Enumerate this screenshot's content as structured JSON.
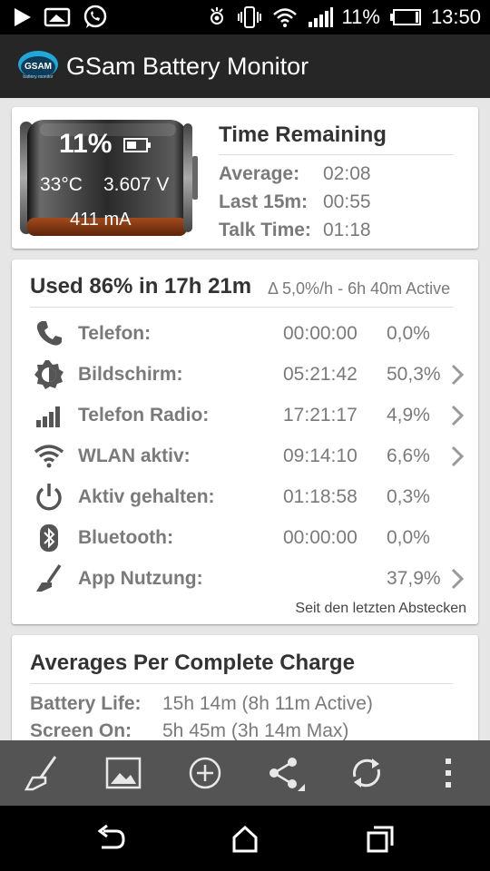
{
  "status_bar": {
    "battery_percent": "11%",
    "time": "13:50",
    "icons": [
      "play-icon",
      "image-icon",
      "whatsapp-icon",
      "gyroscope-icon",
      "vibrate-icon",
      "wifi-icon",
      "signal-icon",
      "battery-icon"
    ]
  },
  "app_bar": {
    "title": "GSam Battery Monitor",
    "logo_text": "GSAM",
    "logo_subtext": "battery monitor"
  },
  "battery_card": {
    "percent": "11%",
    "temperature": "33°C",
    "voltage": "3.607 V",
    "current": "411 mA",
    "charge_level": 0.11,
    "time_remaining": {
      "title": "Time Remaining",
      "rows": [
        {
          "label": "Average:",
          "value": "02:08"
        },
        {
          "label": "Last 15m:",
          "value": "00:55"
        },
        {
          "label": "Talk Time:",
          "value": "01:18"
        }
      ]
    }
  },
  "usage_card": {
    "headline": "Used 86% in 17h 21m",
    "subline": "Δ 5,0%/h - 6h 40m Active",
    "rows": [
      {
        "icon": "phone-icon",
        "label": "Telefon:",
        "time": "00:00:00",
        "percent": "0,0%",
        "has_chevron": false
      },
      {
        "icon": "brightness-icon",
        "label": "Bildschirm:",
        "time": "05:21:42",
        "percent": "50,3%",
        "has_chevron": true
      },
      {
        "icon": "signal-bars-icon",
        "label": "Telefon Radio:",
        "time": "17:21:17",
        "percent": "4,9%",
        "has_chevron": true
      },
      {
        "icon": "wifi-icon",
        "label": "WLAN aktiv:",
        "time": "09:14:10",
        "percent": "6,6%",
        "has_chevron": true
      },
      {
        "icon": "power-icon",
        "label": "Aktiv gehalten:",
        "time": "01:18:58",
        "percent": "0,3%",
        "has_chevron": false
      },
      {
        "icon": "bluetooth-icon",
        "label": "Bluetooth:",
        "time": "00:00:00",
        "percent": "0,0%",
        "has_chevron": false
      },
      {
        "icon": "broom-icon",
        "label": "App Nutzung:",
        "time": "",
        "percent": "37,9%",
        "has_chevron": true
      }
    ],
    "footer": "Seit den letzten Abstecken"
  },
  "averages_card": {
    "title": "Averages Per Complete Charge",
    "rows": [
      {
        "label": "Battery Life:",
        "value": "15h 14m (8h 11m Active)"
      },
      {
        "label": "Screen On:",
        "value": "5h 45m (3h 14m Max)"
      }
    ]
  },
  "toolbar": {
    "buttons": [
      "broom-icon",
      "image-icon",
      "add-circle-icon",
      "share-icon",
      "refresh-icon",
      "overflow-menu-icon"
    ]
  },
  "nav_bar": {
    "buttons": [
      "back-icon",
      "home-icon",
      "recent-apps-icon"
    ]
  },
  "colors": {
    "accent_cyan": "#22a8d8",
    "text_gray": "#7a7a7a",
    "heading": "#333333",
    "toolbar": "#545454",
    "appbar": "#262626"
  }
}
